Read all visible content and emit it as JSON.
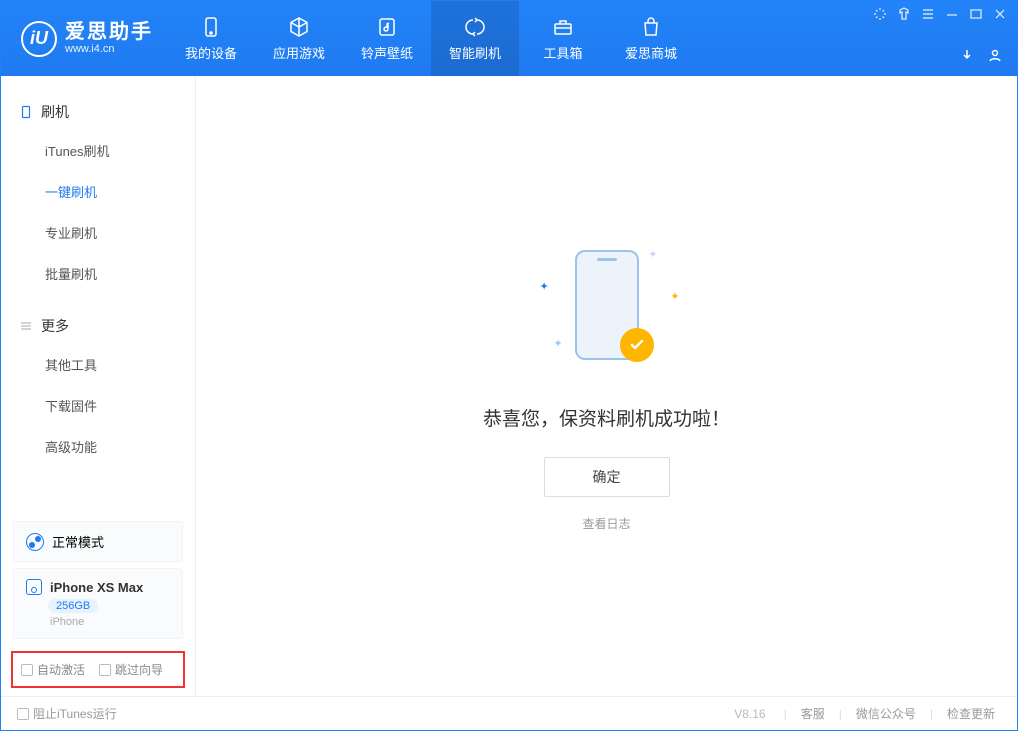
{
  "logo": {
    "letter": "iU",
    "title": "爱思助手",
    "url": "www.i4.cn"
  },
  "nav": {
    "items": [
      {
        "label": "我的设备"
      },
      {
        "label": "应用游戏"
      },
      {
        "label": "铃声壁纸"
      },
      {
        "label": "智能刷机"
      },
      {
        "label": "工具箱"
      },
      {
        "label": "爱思商城"
      }
    ]
  },
  "sidebar": {
    "group1": {
      "title": "刷机",
      "items": [
        "iTunes刷机",
        "一键刷机",
        "专业刷机",
        "批量刷机"
      ]
    },
    "group2": {
      "title": "更多",
      "items": [
        "其他工具",
        "下载固件",
        "高级功能"
      ]
    },
    "mode": "正常模式",
    "device": {
      "name": "iPhone XS Max",
      "storage": "256GB",
      "type": "iPhone"
    },
    "highlight": {
      "auto_activate": "自动激活",
      "skip_guide": "跳过向导"
    }
  },
  "main": {
    "success_text": "恭喜您，保资料刷机成功啦！",
    "ok_label": "确定",
    "log_link": "查看日志"
  },
  "footer": {
    "block_itunes": "阻止iTunes运行",
    "version": "V8.16",
    "links": [
      "客服",
      "微信公众号",
      "检查更新"
    ]
  }
}
